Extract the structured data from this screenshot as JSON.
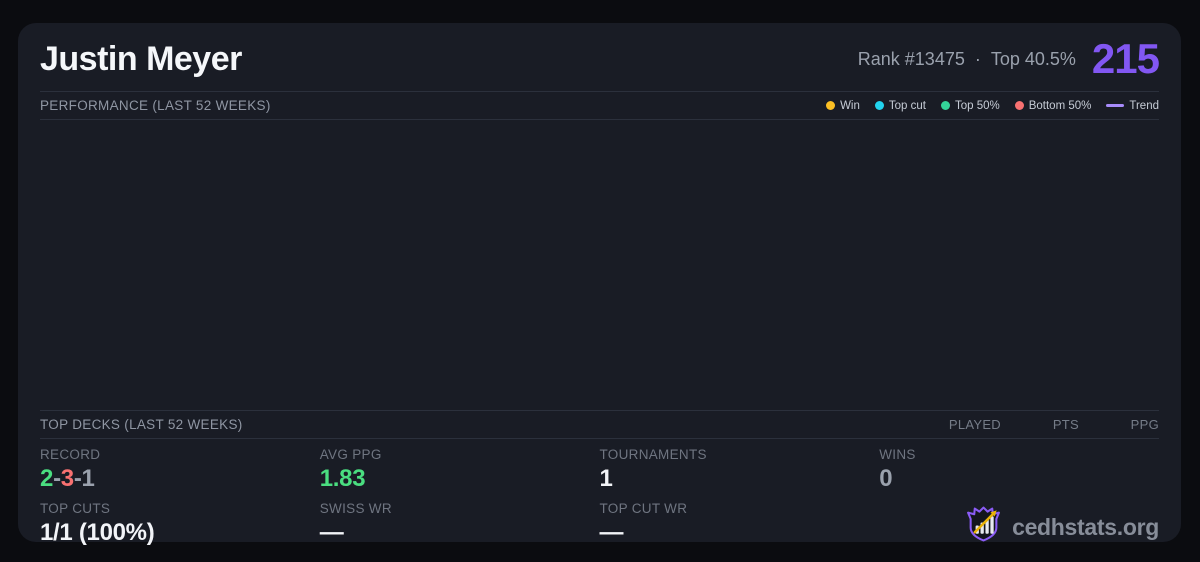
{
  "header": {
    "player_name": "Justin Meyer",
    "rank": "Rank #13475",
    "separator": "·",
    "top_percent": "Top 40.5%",
    "points": "215"
  },
  "performance": {
    "title": "PERFORMANCE (LAST 52 WEEKS)",
    "legend": [
      {
        "name": "win",
        "label": "Win",
        "color": "#fbbf24",
        "swatch": "dot"
      },
      {
        "name": "top-cut",
        "label": "Top cut",
        "color": "#22d3ee",
        "swatch": "dot"
      },
      {
        "name": "top-50",
        "label": "Top 50%",
        "color": "#34d399",
        "swatch": "dot"
      },
      {
        "name": "bottom-50",
        "label": "Bottom 50%",
        "color": "#f87171",
        "swatch": "dot"
      },
      {
        "name": "trend",
        "label": "Trend",
        "color": "#a78bfa",
        "swatch": "line"
      }
    ],
    "chart_points": []
  },
  "top_decks": {
    "title": "TOP DECKS (LAST 52 WEEKS)",
    "columns": [
      "PLAYED",
      "PTS",
      "PPG"
    ],
    "rows": []
  },
  "stats": {
    "record": {
      "label": "RECORD",
      "wins": "2",
      "sep": "-",
      "losses": "3",
      "draws": "1"
    },
    "avg_ppg": {
      "label": "AVG PPG",
      "value": "1.83"
    },
    "tournaments": {
      "label": "TOURNAMENTS",
      "value": "1"
    },
    "wins": {
      "label": "WINS",
      "value": "0"
    },
    "top_cuts": {
      "label": "TOP CUTS",
      "value": "1/1 (100%)"
    },
    "swiss_wr": {
      "label": "SWISS WR",
      "value": "—"
    },
    "top_cut_wr": {
      "label": "TOP CUT WR",
      "value": "—"
    }
  },
  "branding": {
    "site": "cedhstats.org",
    "logo_icon": "bar-chart-shield-icon"
  },
  "colors": {
    "page_bg": "#0b0c10",
    "card_bg": "#191c25",
    "divider": "#2b303c",
    "accent_purple": "#8257f2",
    "win_green": "#4ade80",
    "loss_red": "#f87171",
    "muted_gray": "#9aa1ad",
    "legend_yellow": "#fbbf24",
    "legend_cyan": "#22d3ee",
    "legend_green": "#34d399",
    "legend_red": "#f87171",
    "trend_purple": "#a78bfa",
    "arrow_gold": "#eab308"
  }
}
